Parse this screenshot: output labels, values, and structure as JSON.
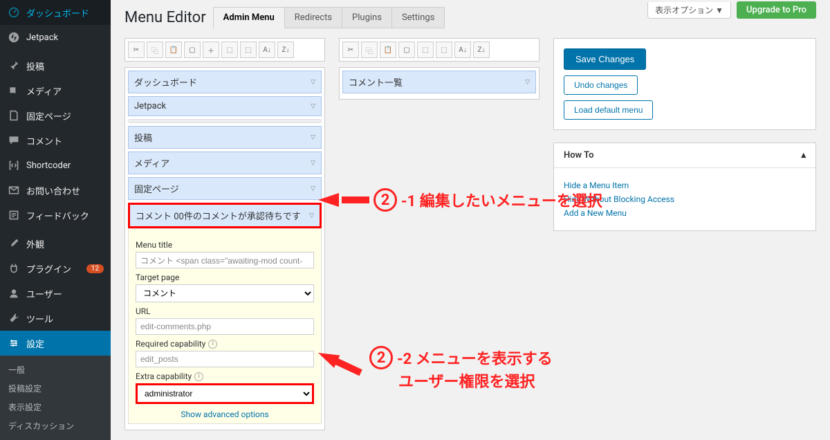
{
  "sidebar": {
    "items": [
      {
        "icon": "dashboard",
        "label": "ダッシュボード"
      },
      {
        "icon": "jetpack",
        "label": "Jetpack"
      },
      {
        "icon": "pin",
        "label": "投稿"
      },
      {
        "icon": "media",
        "label": "メディア"
      },
      {
        "icon": "page",
        "label": "固定ページ"
      },
      {
        "icon": "comment",
        "label": "コメント"
      },
      {
        "icon": "shortcode",
        "label": "Shortcoder"
      },
      {
        "icon": "mail",
        "label": "お問い合わせ"
      },
      {
        "icon": "feedback",
        "label": "フィードバック"
      },
      {
        "icon": "brush",
        "label": "外観"
      },
      {
        "icon": "plugin",
        "label": "プラグイン",
        "badge": "12"
      },
      {
        "icon": "user",
        "label": "ユーザー"
      },
      {
        "icon": "tool",
        "label": "ツール"
      },
      {
        "icon": "settings",
        "label": "設定",
        "active": true
      }
    ],
    "subitems": [
      "一般",
      "投稿設定",
      "表示設定",
      "ディスカッション"
    ]
  },
  "header": {
    "title": "Menu Editor",
    "tabs": [
      "Admin Menu",
      "Redirects",
      "Plugins",
      "Settings"
    ],
    "screen_options": "表示オプション ▼",
    "upgrade": "Upgrade to Pro"
  },
  "left_menu": {
    "items": [
      {
        "label": "ダッシュボード"
      },
      {
        "label": "Jetpack"
      },
      {
        "sep": true
      },
      {
        "label": "投稿"
      },
      {
        "label": "メディア"
      },
      {
        "label": "固定ページ"
      },
      {
        "label": "コメント 00件のコメントが承認待ちです",
        "selected": true
      }
    ]
  },
  "details": {
    "menu_title_label": "Menu title",
    "menu_title_value": "コメント <span class=\"awaiting-mod count-",
    "target_page_label": "Target page",
    "target_page_value": "コメント",
    "url_label": "URL",
    "url_value": "edit-comments.php",
    "req_cap_label": "Required capability",
    "req_cap_value": "edit_posts",
    "extra_cap_label": "Extra capability",
    "extra_cap_value": "administrator",
    "advanced": "Show advanced options"
  },
  "mid_menu": {
    "items": [
      {
        "label": "コメント一覧"
      }
    ]
  },
  "actions": {
    "save": "Save Changes",
    "undo": "Undo changes",
    "load": "Load default menu"
  },
  "howto": {
    "title": "How To",
    "links": [
      "Hide a Menu Item",
      "Hide Without Blocking Access",
      "Add a New Menu"
    ]
  },
  "annotations": {
    "a1": "-1 編集したいメニューを選択",
    "a2_line1": "-2 メニューを表示する",
    "a2_line2": "ユーザー権限を選択"
  }
}
